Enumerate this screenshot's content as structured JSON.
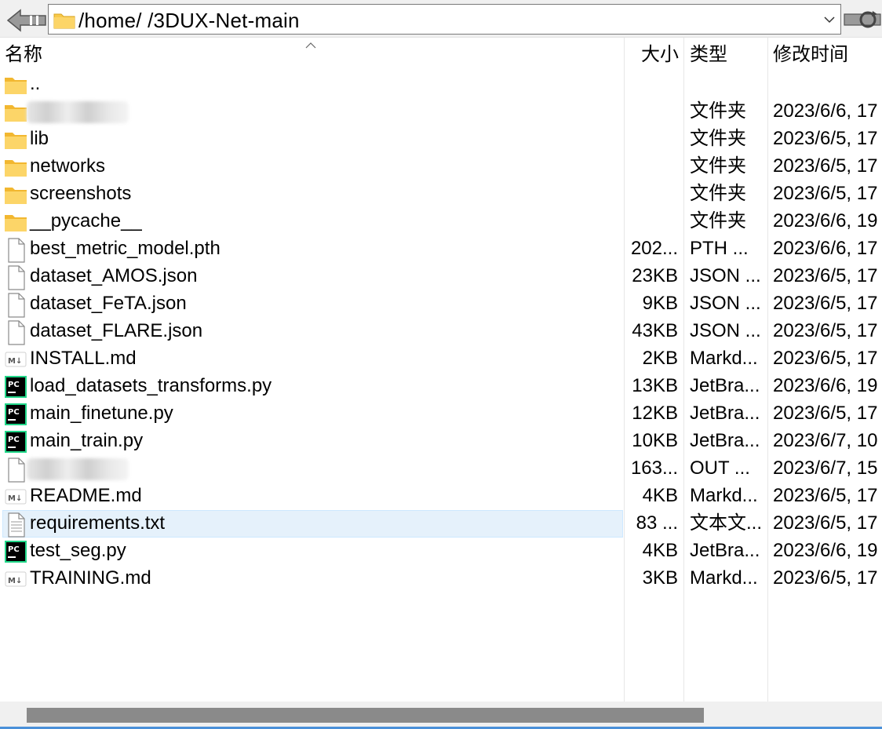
{
  "address": {
    "path": "/home/     /3DUX-Net-main"
  },
  "columns": {
    "name": "名称",
    "size": "大小",
    "type": "类型",
    "modified": "修改时间"
  },
  "rows": [
    {
      "icon": "folder-icon",
      "name": "..",
      "size": "",
      "type": "",
      "modified": ""
    },
    {
      "icon": "folder-icon",
      "name": "",
      "redacted": true,
      "size": "",
      "type": "文件夹",
      "modified": "2023/6/6, 17"
    },
    {
      "icon": "folder-icon",
      "name": "lib",
      "size": "",
      "type": "文件夹",
      "modified": "2023/6/5, 17"
    },
    {
      "icon": "folder-icon",
      "name": "networks",
      "size": "",
      "type": "文件夹",
      "modified": "2023/6/5, 17"
    },
    {
      "icon": "folder-icon",
      "name": "screenshots",
      "size": "",
      "type": "文件夹",
      "modified": "2023/6/5, 17"
    },
    {
      "icon": "folder-icon",
      "name": "__pycache__",
      "size": "",
      "type": "文件夹",
      "modified": "2023/6/6, 19"
    },
    {
      "icon": "file-icon",
      "name": "best_metric_model.pth",
      "size": "202...",
      "type": "PTH ...",
      "modified": "2023/6/6, 17"
    },
    {
      "icon": "file-icon",
      "name": "dataset_AMOS.json",
      "size": "23KB",
      "type": "JSON ...",
      "modified": "2023/6/5, 17"
    },
    {
      "icon": "file-icon",
      "name": "dataset_FeTA.json",
      "size": "9KB",
      "type": "JSON ...",
      "modified": "2023/6/5, 17"
    },
    {
      "icon": "file-icon",
      "name": "dataset_FLARE.json",
      "size": "43KB",
      "type": "JSON ...",
      "modified": "2023/6/5, 17"
    },
    {
      "icon": "markdown-icon",
      "name": "INSTALL.md",
      "size": "2KB",
      "type": "Markd...",
      "modified": "2023/6/5, 17"
    },
    {
      "icon": "pycharm-icon",
      "name": "load_datasets_transforms.py",
      "size": "13KB",
      "type": "JetBra...",
      "modified": "2023/6/6, 19"
    },
    {
      "icon": "pycharm-icon",
      "name": "main_finetune.py",
      "size": "12KB",
      "type": "JetBra...",
      "modified": "2023/6/5, 17"
    },
    {
      "icon": "pycharm-icon",
      "name": "main_train.py",
      "size": "10KB",
      "type": "JetBra...",
      "modified": "2023/6/7, 10"
    },
    {
      "icon": "file-icon",
      "name": "",
      "redacted": true,
      "size": "163...",
      "type": "OUT ...",
      "modified": "2023/6/7, 15"
    },
    {
      "icon": "markdown-icon",
      "name": "README.md",
      "size": "4KB",
      "type": "Markd...",
      "modified": "2023/6/5, 17"
    },
    {
      "icon": "text-file-icon",
      "name": "requirements.txt",
      "size": "83 ...",
      "type": "文本文...",
      "modified": "2023/6/5, 17",
      "selected": true
    },
    {
      "icon": "pycharm-icon",
      "name": "test_seg.py",
      "size": "4KB",
      "type": "JetBra...",
      "modified": "2023/6/6, 19"
    },
    {
      "icon": "markdown-icon",
      "name": "TRAINING.md",
      "size": "3KB",
      "type": "Markd...",
      "modified": "2023/6/5, 17"
    }
  ],
  "colors": {
    "selection": "#e5f1fb",
    "folder": "#f8c94a",
    "pycharm_green": "#21d789"
  },
  "scrollbar": {
    "horizontal_visible_fraction": 0.77
  }
}
